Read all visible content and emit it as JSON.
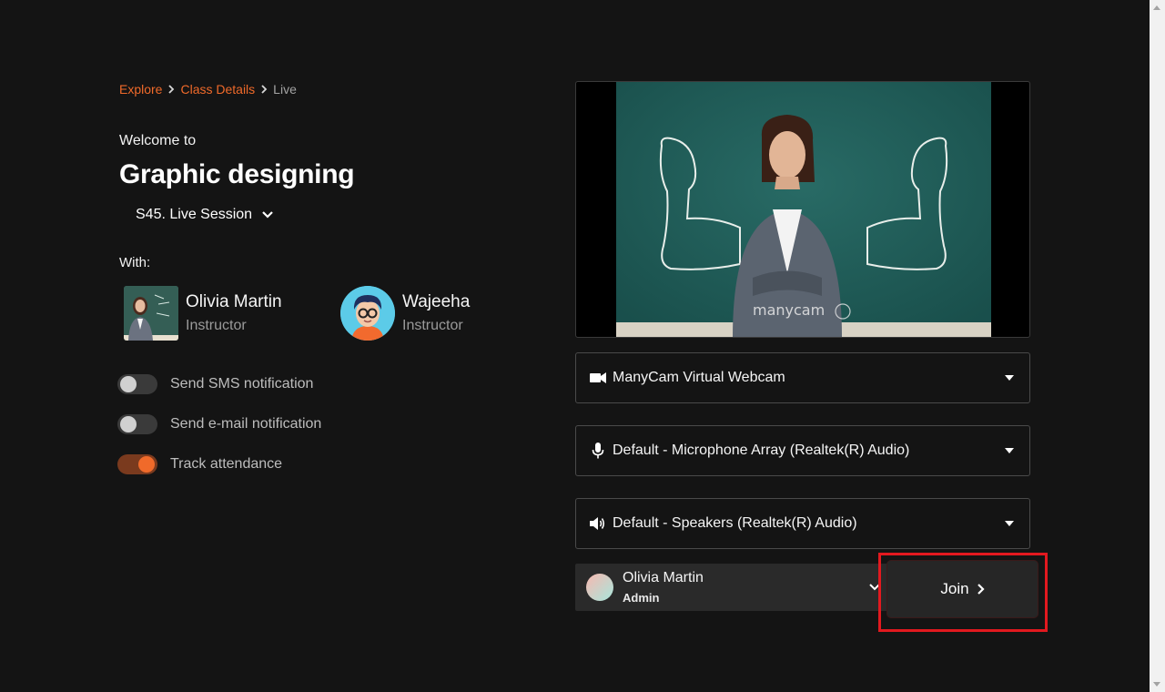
{
  "breadcrumb": {
    "items": [
      {
        "label": "Explore"
      },
      {
        "label": "Class Details"
      },
      {
        "label": "Live"
      }
    ]
  },
  "header": {
    "welcome": "Welcome to",
    "class_title": "Graphic designing",
    "session": "S45. Live Session"
  },
  "instructors": {
    "with_label": "With:",
    "list": [
      {
        "name": "Olivia Martin",
        "role": "Instructor",
        "avatar": "photo-avatar"
      },
      {
        "name": "Wajeeha",
        "role": "Instructor",
        "avatar": "cartoon-avatar"
      }
    ]
  },
  "toggles": [
    {
      "label": "Send SMS notification",
      "on": false
    },
    {
      "label": "Send e-mail notification",
      "on": false
    },
    {
      "label": "Track attendance",
      "on": true
    }
  ],
  "video": {
    "watermark": "manycam"
  },
  "devices": {
    "camera": {
      "value": "ManyCam Virtual Webcam",
      "icon": "video-camera-icon"
    },
    "microphone": {
      "value": "Default - Microphone Array (Realtek(R) Audio)",
      "icon": "microphone-icon"
    },
    "speaker": {
      "value": "Default - Speakers (Realtek(R) Audio)",
      "icon": "speaker-icon"
    }
  },
  "current_user": {
    "name": "Olivia Martin",
    "role": "Admin"
  },
  "join": {
    "label": "Join"
  },
  "colors": {
    "accent": "#f06a2a",
    "background": "#141414",
    "highlight": "#e2191f"
  }
}
